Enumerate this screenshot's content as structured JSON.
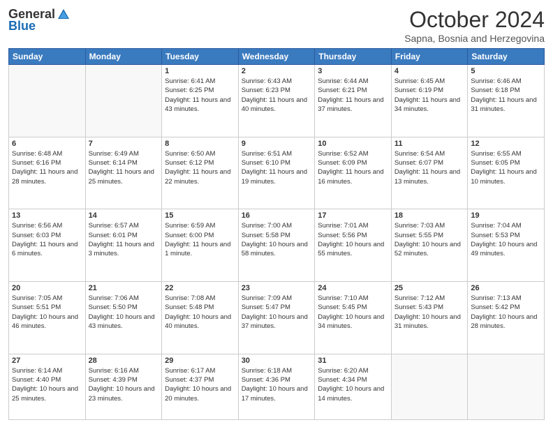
{
  "header": {
    "logo_general": "General",
    "logo_blue": "Blue",
    "month": "October 2024",
    "location": "Sapna, Bosnia and Herzegovina"
  },
  "weekdays": [
    "Sunday",
    "Monday",
    "Tuesday",
    "Wednesday",
    "Thursday",
    "Friday",
    "Saturday"
  ],
  "weeks": [
    [
      {
        "day": "",
        "info": ""
      },
      {
        "day": "",
        "info": ""
      },
      {
        "day": "1",
        "info": "Sunrise: 6:41 AM\nSunset: 6:25 PM\nDaylight: 11 hours and 43 minutes."
      },
      {
        "day": "2",
        "info": "Sunrise: 6:43 AM\nSunset: 6:23 PM\nDaylight: 11 hours and 40 minutes."
      },
      {
        "day": "3",
        "info": "Sunrise: 6:44 AM\nSunset: 6:21 PM\nDaylight: 11 hours and 37 minutes."
      },
      {
        "day": "4",
        "info": "Sunrise: 6:45 AM\nSunset: 6:19 PM\nDaylight: 11 hours and 34 minutes."
      },
      {
        "day": "5",
        "info": "Sunrise: 6:46 AM\nSunset: 6:18 PM\nDaylight: 11 hours and 31 minutes."
      }
    ],
    [
      {
        "day": "6",
        "info": "Sunrise: 6:48 AM\nSunset: 6:16 PM\nDaylight: 11 hours and 28 minutes."
      },
      {
        "day": "7",
        "info": "Sunrise: 6:49 AM\nSunset: 6:14 PM\nDaylight: 11 hours and 25 minutes."
      },
      {
        "day": "8",
        "info": "Sunrise: 6:50 AM\nSunset: 6:12 PM\nDaylight: 11 hours and 22 minutes."
      },
      {
        "day": "9",
        "info": "Sunrise: 6:51 AM\nSunset: 6:10 PM\nDaylight: 11 hours and 19 minutes."
      },
      {
        "day": "10",
        "info": "Sunrise: 6:52 AM\nSunset: 6:09 PM\nDaylight: 11 hours and 16 minutes."
      },
      {
        "day": "11",
        "info": "Sunrise: 6:54 AM\nSunset: 6:07 PM\nDaylight: 11 hours and 13 minutes."
      },
      {
        "day": "12",
        "info": "Sunrise: 6:55 AM\nSunset: 6:05 PM\nDaylight: 11 hours and 10 minutes."
      }
    ],
    [
      {
        "day": "13",
        "info": "Sunrise: 6:56 AM\nSunset: 6:03 PM\nDaylight: 11 hours and 6 minutes."
      },
      {
        "day": "14",
        "info": "Sunrise: 6:57 AM\nSunset: 6:01 PM\nDaylight: 11 hours and 3 minutes."
      },
      {
        "day": "15",
        "info": "Sunrise: 6:59 AM\nSunset: 6:00 PM\nDaylight: 11 hours and 1 minute."
      },
      {
        "day": "16",
        "info": "Sunrise: 7:00 AM\nSunset: 5:58 PM\nDaylight: 10 hours and 58 minutes."
      },
      {
        "day": "17",
        "info": "Sunrise: 7:01 AM\nSunset: 5:56 PM\nDaylight: 10 hours and 55 minutes."
      },
      {
        "day": "18",
        "info": "Sunrise: 7:03 AM\nSunset: 5:55 PM\nDaylight: 10 hours and 52 minutes."
      },
      {
        "day": "19",
        "info": "Sunrise: 7:04 AM\nSunset: 5:53 PM\nDaylight: 10 hours and 49 minutes."
      }
    ],
    [
      {
        "day": "20",
        "info": "Sunrise: 7:05 AM\nSunset: 5:51 PM\nDaylight: 10 hours and 46 minutes."
      },
      {
        "day": "21",
        "info": "Sunrise: 7:06 AM\nSunset: 5:50 PM\nDaylight: 10 hours and 43 minutes."
      },
      {
        "day": "22",
        "info": "Sunrise: 7:08 AM\nSunset: 5:48 PM\nDaylight: 10 hours and 40 minutes."
      },
      {
        "day": "23",
        "info": "Sunrise: 7:09 AM\nSunset: 5:47 PM\nDaylight: 10 hours and 37 minutes."
      },
      {
        "day": "24",
        "info": "Sunrise: 7:10 AM\nSunset: 5:45 PM\nDaylight: 10 hours and 34 minutes."
      },
      {
        "day": "25",
        "info": "Sunrise: 7:12 AM\nSunset: 5:43 PM\nDaylight: 10 hours and 31 minutes."
      },
      {
        "day": "26",
        "info": "Sunrise: 7:13 AM\nSunset: 5:42 PM\nDaylight: 10 hours and 28 minutes."
      }
    ],
    [
      {
        "day": "27",
        "info": "Sunrise: 6:14 AM\nSunset: 4:40 PM\nDaylight: 10 hours and 25 minutes."
      },
      {
        "day": "28",
        "info": "Sunrise: 6:16 AM\nSunset: 4:39 PM\nDaylight: 10 hours and 23 minutes."
      },
      {
        "day": "29",
        "info": "Sunrise: 6:17 AM\nSunset: 4:37 PM\nDaylight: 10 hours and 20 minutes."
      },
      {
        "day": "30",
        "info": "Sunrise: 6:18 AM\nSunset: 4:36 PM\nDaylight: 10 hours and 17 minutes."
      },
      {
        "day": "31",
        "info": "Sunrise: 6:20 AM\nSunset: 4:34 PM\nDaylight: 10 hours and 14 minutes."
      },
      {
        "day": "",
        "info": ""
      },
      {
        "day": "",
        "info": ""
      }
    ]
  ]
}
